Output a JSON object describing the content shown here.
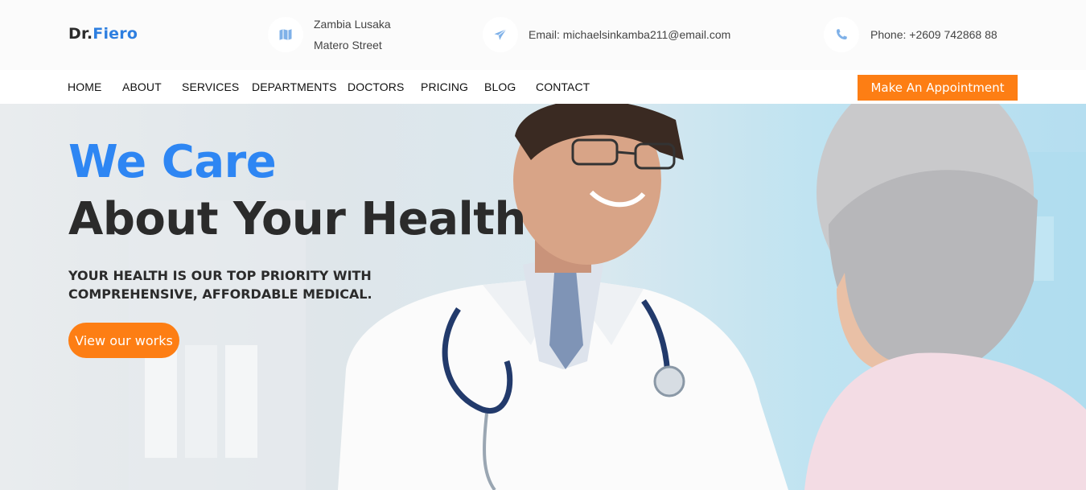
{
  "brand": {
    "prefix": "Dr.",
    "name": "Fiero"
  },
  "contact": {
    "address_line1": "Zambia Lusaka",
    "address_line2": "Matero Street",
    "email": "Email: michaelsinkamba211@email.com",
    "phone": "Phone: +2609 742868 88"
  },
  "nav": {
    "items": [
      "HOME",
      "ABOUT",
      "SERVICES",
      "DEPARTMENTS",
      "DOCTORS",
      "PRICING",
      "BLOG",
      "CONTACT"
    ],
    "cta_label": "Make An Appointment"
  },
  "hero": {
    "title_line1": "We Care",
    "title_line2": "About Your Health",
    "subtitle": "YOUR HEALTH IS OUR TOP PRIORITY WITH COMPREHENSIVE, AFFORDABLE MEDICAL.",
    "button_label": "View our works"
  },
  "colors": {
    "accent_blue": "#2e86f3",
    "accent_orange": "#fd7e14",
    "text_dark": "#2b2b2b"
  },
  "icons": {
    "address": "map-icon",
    "email": "paper-plane-icon",
    "phone": "phone-icon"
  }
}
